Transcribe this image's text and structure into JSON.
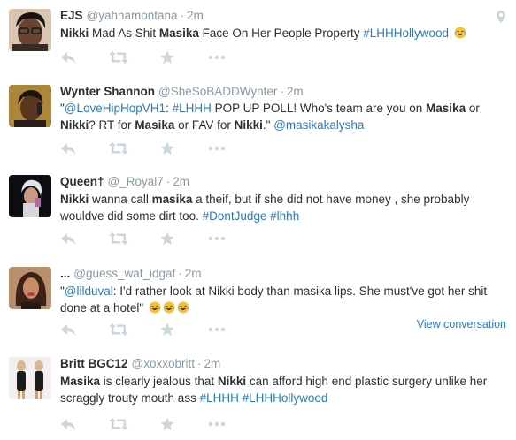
{
  "tweets": [
    {
      "name": "EJS",
      "handle": "@yahnamontana",
      "time": "2m",
      "segments": [
        {
          "t": "Nikki",
          "s": "b"
        },
        {
          "t": " Mad As Shit "
        },
        {
          "t": "Masika",
          "s": "b"
        },
        {
          "t": " Face On Her People Property "
        },
        {
          "t": "#LHHHollywood",
          "s": "link"
        },
        {
          "t": " "
        },
        {
          "t": "laughing-emoji",
          "s": "emoji"
        }
      ]
    },
    {
      "name": "Wynter Shannon",
      "handle": "@SheSoBADDWynter",
      "time": "2m",
      "segments": [
        {
          "t": "\""
        },
        {
          "t": "@LoveHipHopVH1",
          "s": "link"
        },
        {
          "t": ": "
        },
        {
          "t": "#LHHH",
          "s": "link"
        },
        {
          "t": " POP UP POLL! Who's team are you on "
        },
        {
          "t": "Masika",
          "s": "b"
        },
        {
          "t": " or "
        },
        {
          "t": "Nikki",
          "s": "b"
        },
        {
          "t": "? RT for "
        },
        {
          "t": "Masika",
          "s": "b"
        },
        {
          "t": " or FAV for "
        },
        {
          "t": "Nikki",
          "s": "b"
        },
        {
          "t": ".\" "
        },
        {
          "t": "@masikakalysha",
          "s": "link"
        }
      ]
    },
    {
      "name": "Queen†",
      "handle": "@_Royal7",
      "time": "2m",
      "segments": [
        {
          "t": "Nikki",
          "s": "b"
        },
        {
          "t": " wanna call "
        },
        {
          "t": "masika",
          "s": "b"
        },
        {
          "t": " a theif, but if  she did not have money , she probably wouldve did some dirt too. "
        },
        {
          "t": "#DontJudge",
          "s": "link"
        },
        {
          "t": " "
        },
        {
          "t": "#lhhh",
          "s": "link"
        }
      ]
    },
    {
      "name": "...",
      "handle": "@guess_wat_idgaf",
      "time": "2m",
      "view_conversation": "View conversation",
      "segments": [
        {
          "t": "\""
        },
        {
          "t": "@lilduval",
          "s": "link"
        },
        {
          "t": ": I'd rather look at Nikki body than masika lips. She must've got her shit done at a hotel\" "
        },
        {
          "t": "laughing-emoji",
          "s": "emoji"
        },
        {
          "t": "laughing-emoji",
          "s": "emoji"
        },
        {
          "t": "laughing-emoji",
          "s": "emoji"
        }
      ]
    },
    {
      "name": "Britt BGC12",
      "handle": "@xoxxobritt",
      "time": "2m",
      "segments": [
        {
          "t": "Masika",
          "s": "b"
        },
        {
          "t": " is clearly jealous that "
        },
        {
          "t": "Nikki",
          "s": "b"
        },
        {
          "t": " can afford high end plastic surgery unlike her scraggly trouty mouth ass "
        },
        {
          "t": "#LHHH",
          "s": "link"
        },
        {
          "t": " "
        },
        {
          "t": "#LHHHollywood",
          "s": "link"
        }
      ]
    }
  ],
  "icons": {
    "reply": "reply-icon",
    "retweet": "retweet-icon",
    "favorite": "star-icon",
    "more": "more-icon",
    "location": "location-icon"
  },
  "colors": {
    "link": "#2b7bb9",
    "meta": "#8899a6",
    "text": "#292f33",
    "action_icon": "#ccd6dd",
    "divider": "#e1e8ed"
  }
}
